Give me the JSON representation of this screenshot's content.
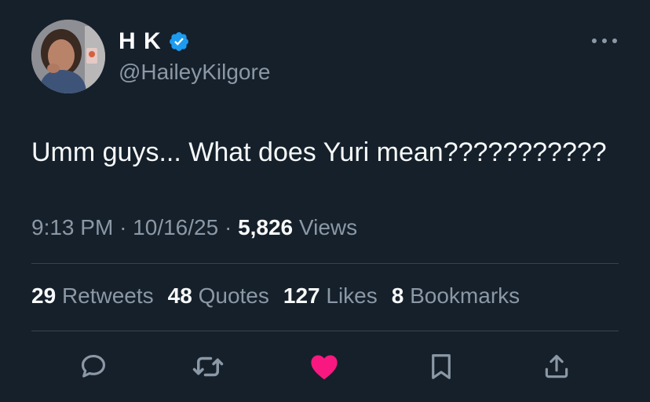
{
  "user": {
    "display_name": "H K",
    "handle": "@HaileyKilgore",
    "verified": true
  },
  "tweet": {
    "text": "Umm guys... What does Yuri mean???????????",
    "time": "9:13 PM",
    "separator": "·",
    "date": "10/16/25",
    "views_count": "5,826",
    "views_label": "Views"
  },
  "stats": [
    {
      "count": "29",
      "label": "Retweets"
    },
    {
      "count": "48",
      "label": "Quotes"
    },
    {
      "count": "127",
      "label": "Likes"
    },
    {
      "count": "8",
      "label": "Bookmarks"
    }
  ],
  "actions": [
    {
      "icon": "reply-icon"
    },
    {
      "icon": "retweet-icon"
    },
    {
      "icon": "like-icon",
      "active": true
    },
    {
      "icon": "bookmark-icon"
    },
    {
      "icon": "share-icon"
    }
  ],
  "colors": {
    "background": "#15202b",
    "secondary_text": "#8b98a5",
    "verified_blue": "#1d9bf0",
    "like_pink": "#f91880",
    "divider": "#38444d"
  }
}
